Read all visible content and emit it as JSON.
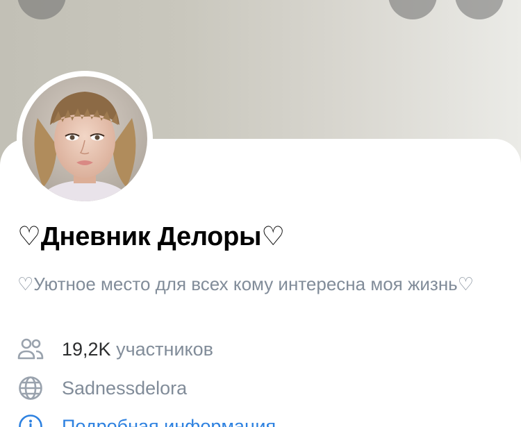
{
  "group": {
    "title": "♡Дневник Делоры♡",
    "description": "♡Уютное место для всех кому интересна моя жизнь♡"
  },
  "info": {
    "members_count": "19,2K",
    "members_label": "участников",
    "website": "Sadnessdelora",
    "details_link": "Подробная информация"
  },
  "icons": {
    "back": "chevron-left-icon",
    "notify": "bell-icon",
    "more": "more-icon",
    "members": "users-icon",
    "website": "globe-icon",
    "details": "info-circle-icon"
  },
  "colors": {
    "secondary_text": "#818c99",
    "link": "#2d81e0",
    "title": "#000000"
  }
}
